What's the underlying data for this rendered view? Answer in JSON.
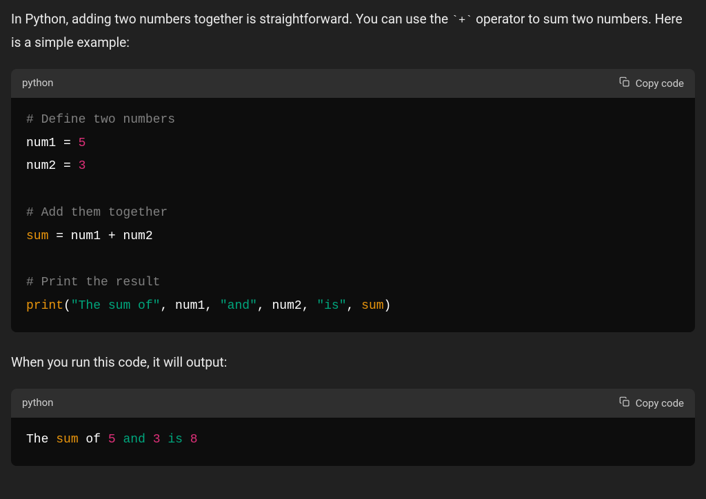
{
  "intro": {
    "part1": "In Python, adding two numbers together is straightforward. You can use the ",
    "code": "`+`",
    "part2": " operator to sum two numbers. Here is a simple example:"
  },
  "code_block_1": {
    "language": "python",
    "copy_label": "Copy code",
    "tokens": {
      "c1": "# Define two numbers",
      "l2a": "num1 = ",
      "l2b": "5",
      "l3a": "num2 = ",
      "l3b": "3",
      "c2": "# Add them together",
      "l5a": "sum",
      "l5b": " = num1 + num2",
      "c3": "# Print the result",
      "l7a": "print",
      "l7b": "(",
      "s1": "\"The sum of\"",
      "l7c": ", num1, ",
      "s2": "\"and\"",
      "l7d": ", num2, ",
      "s3": "\"is\"",
      "l7e": ", ",
      "l7f": "sum",
      "l7g": ")"
    }
  },
  "outro": "When you run this code, it will output:",
  "code_block_2": {
    "language": "python",
    "copy_label": "Copy code",
    "tokens": {
      "t1": "The ",
      "t2": "sum",
      "t3": " of ",
      "t4": "5",
      "t5": " ",
      "and_kw": "and",
      "t6": " ",
      "t7": "3",
      "t8": " ",
      "is_kw": "is",
      "t9": " ",
      "t10": "8"
    }
  },
  "colors": {
    "bg": "#212121",
    "code_bg": "#0d0d0d",
    "header_bg": "#2f2f2f",
    "text": "#ececec",
    "comment": "#808080",
    "number": "#df3079",
    "builtin": "#e9950c",
    "string": "#00a67d"
  }
}
